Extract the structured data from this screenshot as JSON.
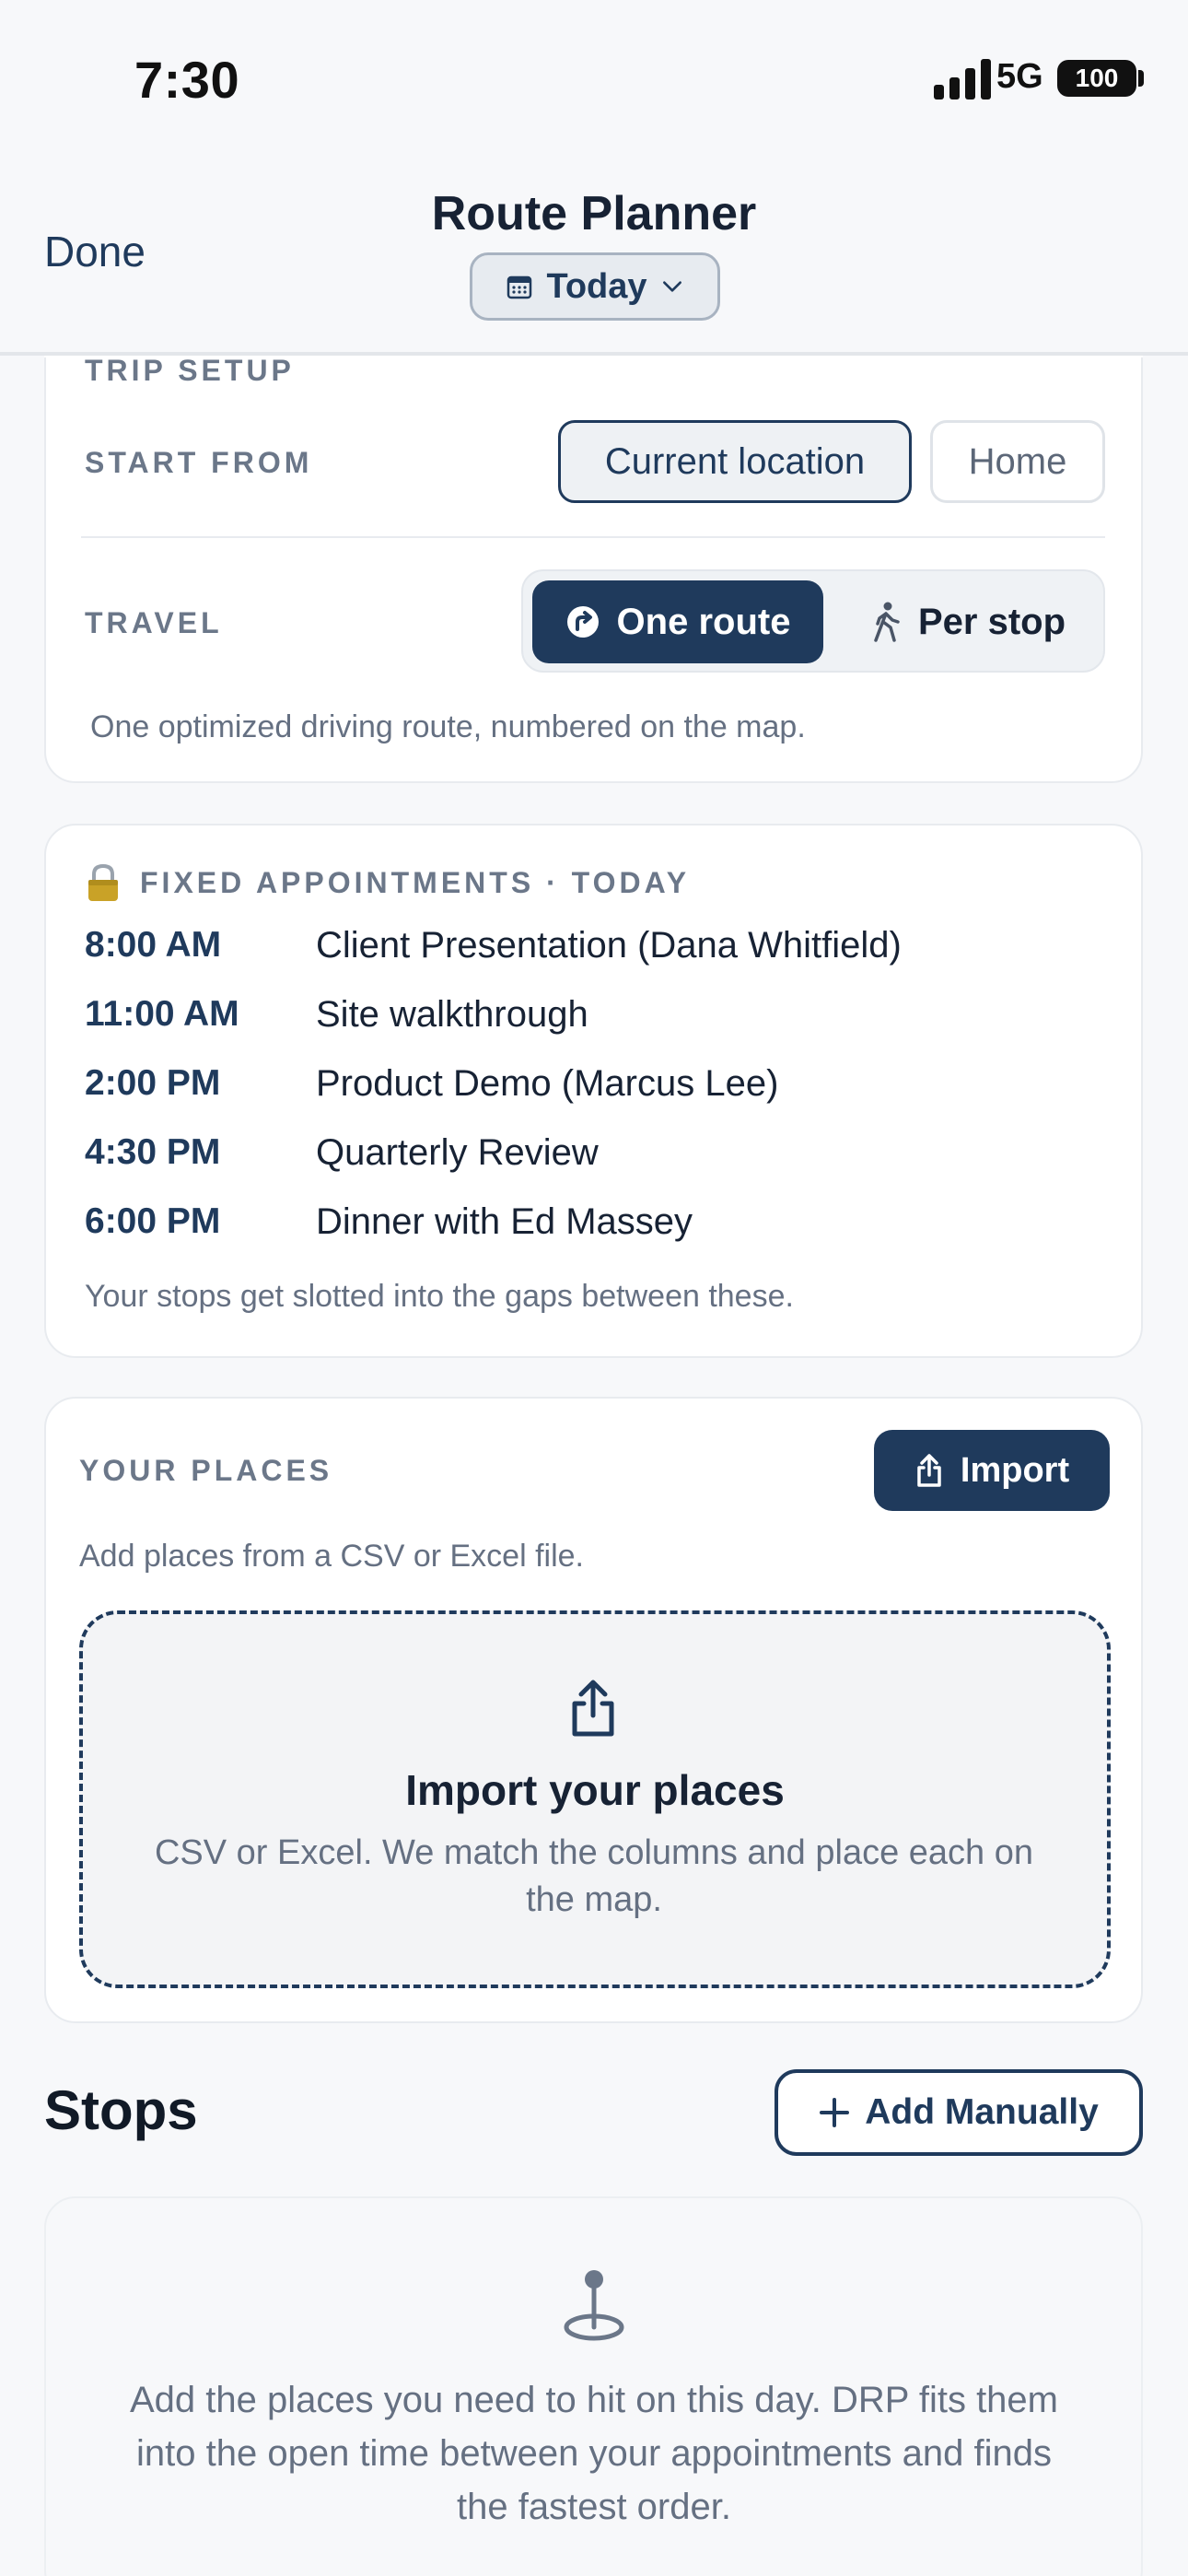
{
  "status_bar": {
    "time": "7:30",
    "network": "5G",
    "battery": "100"
  },
  "nav": {
    "done_label": "Done",
    "title": "Route Planner",
    "date_label": "Today"
  },
  "trip_setup": {
    "heading": "TRIP SETUP",
    "start_from_label": "START FROM",
    "start_options": [
      "Current location",
      "Home"
    ],
    "start_selected": "Current location",
    "travel_label": "TRAVEL",
    "travel_options": [
      "One route",
      "Per stop"
    ],
    "travel_selected": "One route",
    "description": "One optimized driving route, numbered on the map."
  },
  "appointments": {
    "heading": "FIXED APPOINTMENTS · TODAY",
    "items": [
      {
        "time": "8:00 AM",
        "title": "Client Presentation (Dana Whitfield)"
      },
      {
        "time": "11:00 AM",
        "title": "Site walkthrough"
      },
      {
        "time": "2:00 PM",
        "title": "Product Demo (Marcus Lee)"
      },
      {
        "time": "4:30 PM",
        "title": "Quarterly Review"
      },
      {
        "time": "6:00 PM",
        "title": "Dinner with Ed Massey"
      }
    ],
    "footer": "Your stops get slotted into the gaps between these."
  },
  "places": {
    "heading": "YOUR PLACES",
    "import_label": "Import",
    "description": "Add places from a CSV or Excel file.",
    "dropzone_title": "Import your places",
    "dropzone_text": "CSV or Excel. We match the columns and place each on the map."
  },
  "stops": {
    "heading": "Stops",
    "add_label": "Add Manually",
    "empty_text": "Add the places you need to hit on this day. DRP fits them into the open time between your appointments and finds the fastest order."
  },
  "colors": {
    "primary": "#1f3a5c",
    "muted": "#657082",
    "background": "#f7f8fa",
    "card": "#ffffff"
  }
}
